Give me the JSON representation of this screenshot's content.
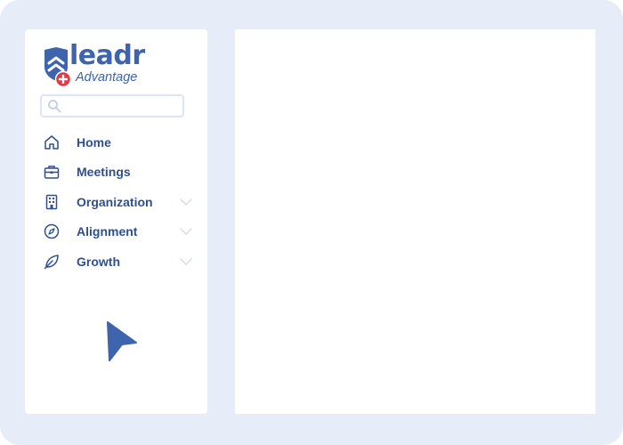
{
  "app": {
    "logo_word": "leadr",
    "logo_subtitle": "Advantage",
    "brand_color": "#3d64ad",
    "accent_color": "#e23b45"
  },
  "search": {
    "placeholder": "",
    "value": "",
    "icon": "search-icon"
  },
  "nav": {
    "items": [
      {
        "label": "Home",
        "icon": "home-icon",
        "expandable": false
      },
      {
        "label": "Meetings",
        "icon": "briefcase-icon",
        "expandable": false
      },
      {
        "label": "Organization",
        "icon": "building-icon",
        "expandable": true
      },
      {
        "label": "Alignment",
        "icon": "compass-icon",
        "expandable": true
      },
      {
        "label": "Growth",
        "icon": "leaf-icon",
        "expandable": true
      }
    ]
  },
  "colors": {
    "frame_background": "#e6edf8",
    "nav_text": "#2f4f8f",
    "chevron": "#d3ddef",
    "cursor": "#3d64ad"
  }
}
